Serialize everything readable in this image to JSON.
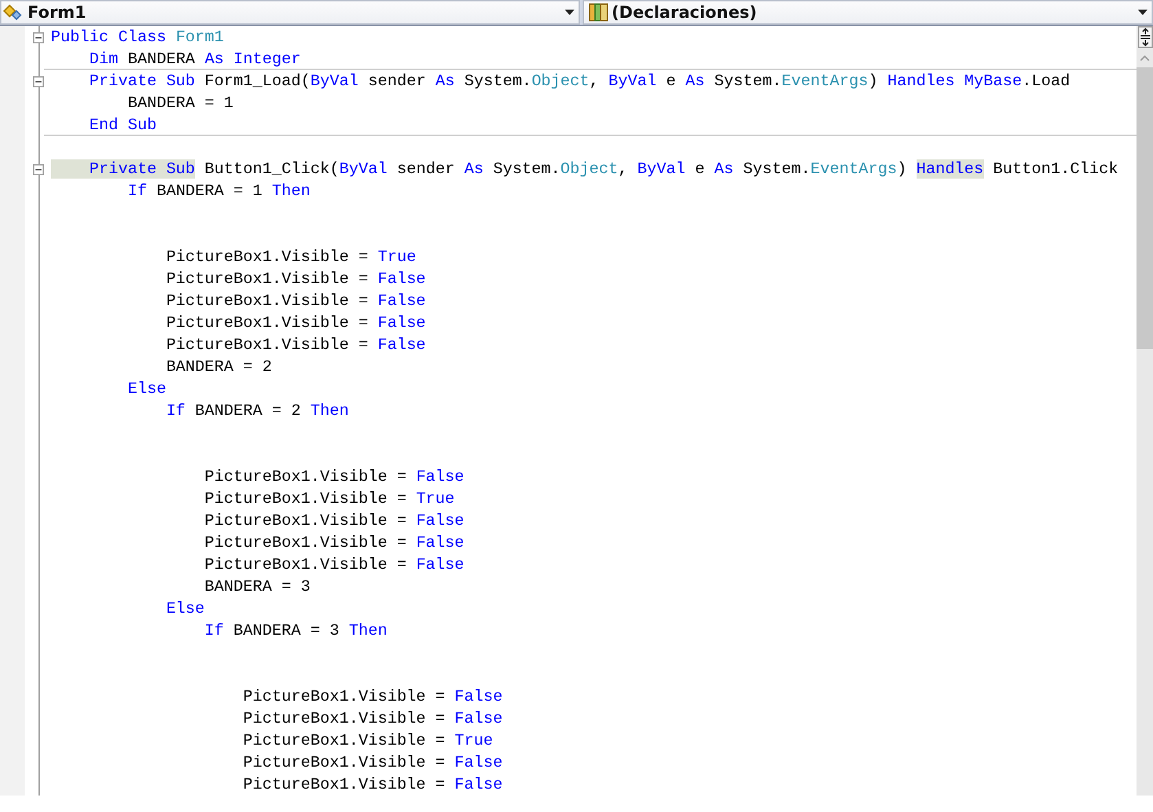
{
  "navigation_bar": {
    "class_dropdown": {
      "value": "Form1"
    },
    "member_dropdown": {
      "value": "(Declaraciones)"
    }
  },
  "code_lines": [
    {
      "kind": "code",
      "fold_box": true,
      "separator_after": false,
      "tokens": [
        {
          "text": "Public Class ",
          "kind": "keyword"
        },
        {
          "text": "Form1",
          "kind": "type"
        }
      ]
    },
    {
      "kind": "code",
      "fold_box": false,
      "separator_after": true,
      "tokens": [
        {
          "text": "    Dim",
          "kind": "keyword"
        },
        {
          "text": " BANDERA ",
          "kind": "plain"
        },
        {
          "text": "As Integer",
          "kind": "keyword"
        }
      ]
    },
    {
      "kind": "code",
      "fold_box": true,
      "separator_after": false,
      "tokens": [
        {
          "text": "    Private Sub",
          "kind": "keyword"
        },
        {
          "text": " Form1_Load(",
          "kind": "plain"
        },
        {
          "text": "ByVal",
          "kind": "keyword"
        },
        {
          "text": " sender ",
          "kind": "plain"
        },
        {
          "text": "As",
          "kind": "keyword"
        },
        {
          "text": " System.",
          "kind": "plain"
        },
        {
          "text": "Object",
          "kind": "type"
        },
        {
          "text": ", ",
          "kind": "plain"
        },
        {
          "text": "ByVal",
          "kind": "keyword"
        },
        {
          "text": " e ",
          "kind": "plain"
        },
        {
          "text": "As",
          "kind": "keyword"
        },
        {
          "text": " System.",
          "kind": "plain"
        },
        {
          "text": "EventArgs",
          "kind": "type"
        },
        {
          "text": ") ",
          "kind": "plain"
        },
        {
          "text": "Handles MyBase",
          "kind": "keyword"
        },
        {
          "text": ".Load",
          "kind": "plain"
        }
      ]
    },
    {
      "kind": "code",
      "fold_box": false,
      "separator_after": false,
      "tokens": [
        {
          "text": "        BANDERA = 1",
          "kind": "plain"
        }
      ]
    },
    {
      "kind": "code",
      "fold_box": false,
      "separator_after": true,
      "tokens": [
        {
          "text": "    End Sub",
          "kind": "keyword"
        }
      ]
    },
    {
      "kind": "blank"
    },
    {
      "kind": "code",
      "fold_box": true,
      "separator_after": false,
      "tokens": [
        {
          "text": "    Private Sub",
          "kind": "highlighted_keyword"
        },
        {
          "text": " Button1_Click(",
          "kind": "plain"
        },
        {
          "text": "ByVal",
          "kind": "keyword"
        },
        {
          "text": " sender ",
          "kind": "plain"
        },
        {
          "text": "As",
          "kind": "keyword"
        },
        {
          "text": " System.",
          "kind": "plain"
        },
        {
          "text": "Object",
          "kind": "type"
        },
        {
          "text": ", ",
          "kind": "plain"
        },
        {
          "text": "ByVal",
          "kind": "keyword"
        },
        {
          "text": " e ",
          "kind": "plain"
        },
        {
          "text": "As",
          "kind": "keyword"
        },
        {
          "text": " System.",
          "kind": "plain"
        },
        {
          "text": "EventArgs",
          "kind": "type"
        },
        {
          "text": ") ",
          "kind": "plain"
        },
        {
          "text": "Handles",
          "kind": "highlighted_keyword"
        },
        {
          "text": " Button1.Click",
          "kind": "plain"
        }
      ]
    },
    {
      "kind": "code",
      "fold_box": false,
      "separator_after": false,
      "tokens": [
        {
          "text": "        If",
          "kind": "keyword"
        },
        {
          "text": " BANDERA = 1 ",
          "kind": "plain"
        },
        {
          "text": "Then",
          "kind": "keyword"
        }
      ]
    },
    {
      "kind": "blank"
    },
    {
      "kind": "blank"
    },
    {
      "kind": "code",
      "fold_box": false,
      "separator_after": false,
      "tokens": [
        {
          "text": "            PictureBox1.Visible = ",
          "kind": "plain"
        },
        {
          "text": "True",
          "kind": "keyword"
        }
      ]
    },
    {
      "kind": "code",
      "fold_box": false,
      "separator_after": false,
      "tokens": [
        {
          "text": "            PictureBox1.Visible = ",
          "kind": "plain"
        },
        {
          "text": "False",
          "kind": "keyword"
        }
      ]
    },
    {
      "kind": "code",
      "fold_box": false,
      "separator_after": false,
      "tokens": [
        {
          "text": "            PictureBox1.Visible = ",
          "kind": "plain"
        },
        {
          "text": "False",
          "kind": "keyword"
        }
      ]
    },
    {
      "kind": "code",
      "fold_box": false,
      "separator_after": false,
      "tokens": [
        {
          "text": "            PictureBox1.Visible = ",
          "kind": "plain"
        },
        {
          "text": "False",
          "kind": "keyword"
        }
      ]
    },
    {
      "kind": "code",
      "fold_box": false,
      "separator_after": false,
      "tokens": [
        {
          "text": "            PictureBox1.Visible = ",
          "kind": "plain"
        },
        {
          "text": "False",
          "kind": "keyword"
        }
      ]
    },
    {
      "kind": "code",
      "fold_box": false,
      "separator_after": false,
      "tokens": [
        {
          "text": "            BANDERA = 2",
          "kind": "plain"
        }
      ]
    },
    {
      "kind": "code",
      "fold_box": false,
      "separator_after": false,
      "tokens": [
        {
          "text": "        Else",
          "kind": "keyword"
        }
      ]
    },
    {
      "kind": "code",
      "fold_box": false,
      "separator_after": false,
      "tokens": [
        {
          "text": "            If",
          "kind": "keyword"
        },
        {
          "text": " BANDERA = 2 ",
          "kind": "plain"
        },
        {
          "text": "Then",
          "kind": "keyword"
        }
      ]
    },
    {
      "kind": "blank"
    },
    {
      "kind": "blank"
    },
    {
      "kind": "code",
      "fold_box": false,
      "separator_after": false,
      "tokens": [
        {
          "text": "                PictureBox1.Visible = ",
          "kind": "plain"
        },
        {
          "text": "False",
          "kind": "keyword"
        }
      ]
    },
    {
      "kind": "code",
      "fold_box": false,
      "separator_after": false,
      "tokens": [
        {
          "text": "                PictureBox1.Visible = ",
          "kind": "plain"
        },
        {
          "text": "True",
          "kind": "keyword"
        }
      ]
    },
    {
      "kind": "code",
      "fold_box": false,
      "separator_after": false,
      "tokens": [
        {
          "text": "                PictureBox1.Visible = ",
          "kind": "plain"
        },
        {
          "text": "False",
          "kind": "keyword"
        }
      ]
    },
    {
      "kind": "code",
      "fold_box": false,
      "separator_after": false,
      "tokens": [
        {
          "text": "                PictureBox1.Visible = ",
          "kind": "plain"
        },
        {
          "text": "False",
          "kind": "keyword"
        }
      ]
    },
    {
      "kind": "code",
      "fold_box": false,
      "separator_after": false,
      "tokens": [
        {
          "text": "                PictureBox1.Visible = ",
          "kind": "plain"
        },
        {
          "text": "False",
          "kind": "keyword"
        }
      ]
    },
    {
      "kind": "code",
      "fold_box": false,
      "separator_after": false,
      "tokens": [
        {
          "text": "                BANDERA = 3",
          "kind": "plain"
        }
      ]
    },
    {
      "kind": "code",
      "fold_box": false,
      "separator_after": false,
      "tokens": [
        {
          "text": "            Else",
          "kind": "keyword"
        }
      ]
    },
    {
      "kind": "code",
      "fold_box": false,
      "separator_after": false,
      "tokens": [
        {
          "text": "                If",
          "kind": "keyword"
        },
        {
          "text": " BANDERA = 3 ",
          "kind": "plain"
        },
        {
          "text": "Then",
          "kind": "keyword"
        }
      ]
    },
    {
      "kind": "blank"
    },
    {
      "kind": "blank"
    },
    {
      "kind": "code",
      "fold_box": false,
      "separator_after": false,
      "tokens": [
        {
          "text": "                    PictureBox1.Visible = ",
          "kind": "plain"
        },
        {
          "text": "False",
          "kind": "keyword"
        }
      ]
    },
    {
      "kind": "code",
      "fold_box": false,
      "separator_after": false,
      "tokens": [
        {
          "text": "                    PictureBox1.Visible = ",
          "kind": "plain"
        },
        {
          "text": "False",
          "kind": "keyword"
        }
      ]
    },
    {
      "kind": "code",
      "fold_box": false,
      "separator_after": false,
      "tokens": [
        {
          "text": "                    PictureBox1.Visible = ",
          "kind": "plain"
        },
        {
          "text": "True",
          "kind": "keyword"
        }
      ]
    },
    {
      "kind": "code",
      "fold_box": false,
      "separator_after": false,
      "tokens": [
        {
          "text": "                    PictureBox1.Visible = ",
          "kind": "plain"
        },
        {
          "text": "False",
          "kind": "keyword"
        }
      ]
    },
    {
      "kind": "code",
      "fold_box": false,
      "separator_after": false,
      "tokens": [
        {
          "text": "                    PictureBox1.Visible = ",
          "kind": "plain"
        },
        {
          "text": "False",
          "kind": "keyword"
        }
      ]
    }
  ]
}
